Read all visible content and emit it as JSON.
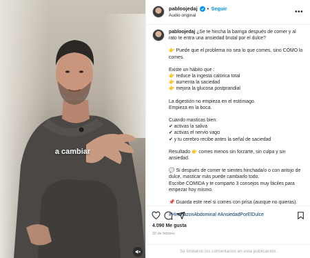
{
  "video": {
    "caption": "a cambiar"
  },
  "header": {
    "username": "pabloojedaj",
    "separator": "•",
    "follow_label": "Seguir",
    "audio_label": "Audio original",
    "more_label": "•••"
  },
  "post": {
    "username": "pabloojedaj",
    "first_line": "¿Se te hincha la barriga después de comer y al",
    "lines": [
      [
        "rato te entra una ansiedad brutal por el dulce?"
      ],
      [
        "👉 Puede que el problema no sea lo que comes, sino CÓMO lo",
        "comes."
      ],
      [
        "Existe un hábito que :",
        "👉 reduce la ingesta calórica total",
        "👉 aumenta la saciedad",
        "👉 mejora la glucosa postprandial"
      ],
      [
        "La digestión no empieza en el estómago.",
        "Empieza en la boca."
      ],
      [
        "Cuando masticas bien:",
        "✔ activas la saliva",
        "✔ activas el nervio vago",
        "✔ y tu cerebro recibe antes la señal de saciedad"
      ],
      [
        "Resultado 👉 comes menos sin forzarte, sin culpa y sin",
        "ansiedad."
      ],
      [
        "💬 Si después de comer te sientes hinchada/o o con antojo de",
        "dulce, masticar más puede cambiarlo todo.",
        "Escribe COMIDA y te comparto 3 consejos muy fáciles para",
        "empezar hoy mismo."
      ],
      [
        "📌 Guarda este reel si comes con prisa (aunque no quieras)."
      ]
    ],
    "hashtags": "#HinchazonAbdominal #AnsiedadPorElDulce"
  },
  "stats": {
    "likes": "4.090 Me gusta",
    "date": "20 de febrero"
  },
  "footer": {
    "comments_limited": "Se limitaron los comentarios en esta publicación."
  },
  "colors": {
    "link_blue": "#0095f6",
    "hashtag_blue": "#00376b",
    "text": "#262626",
    "muted": "#8e8e8e"
  },
  "icons": [
    "heart-icon",
    "comment-icon",
    "share-icon",
    "bookmark-icon",
    "more-icon",
    "verified-icon",
    "mute-icon"
  ]
}
